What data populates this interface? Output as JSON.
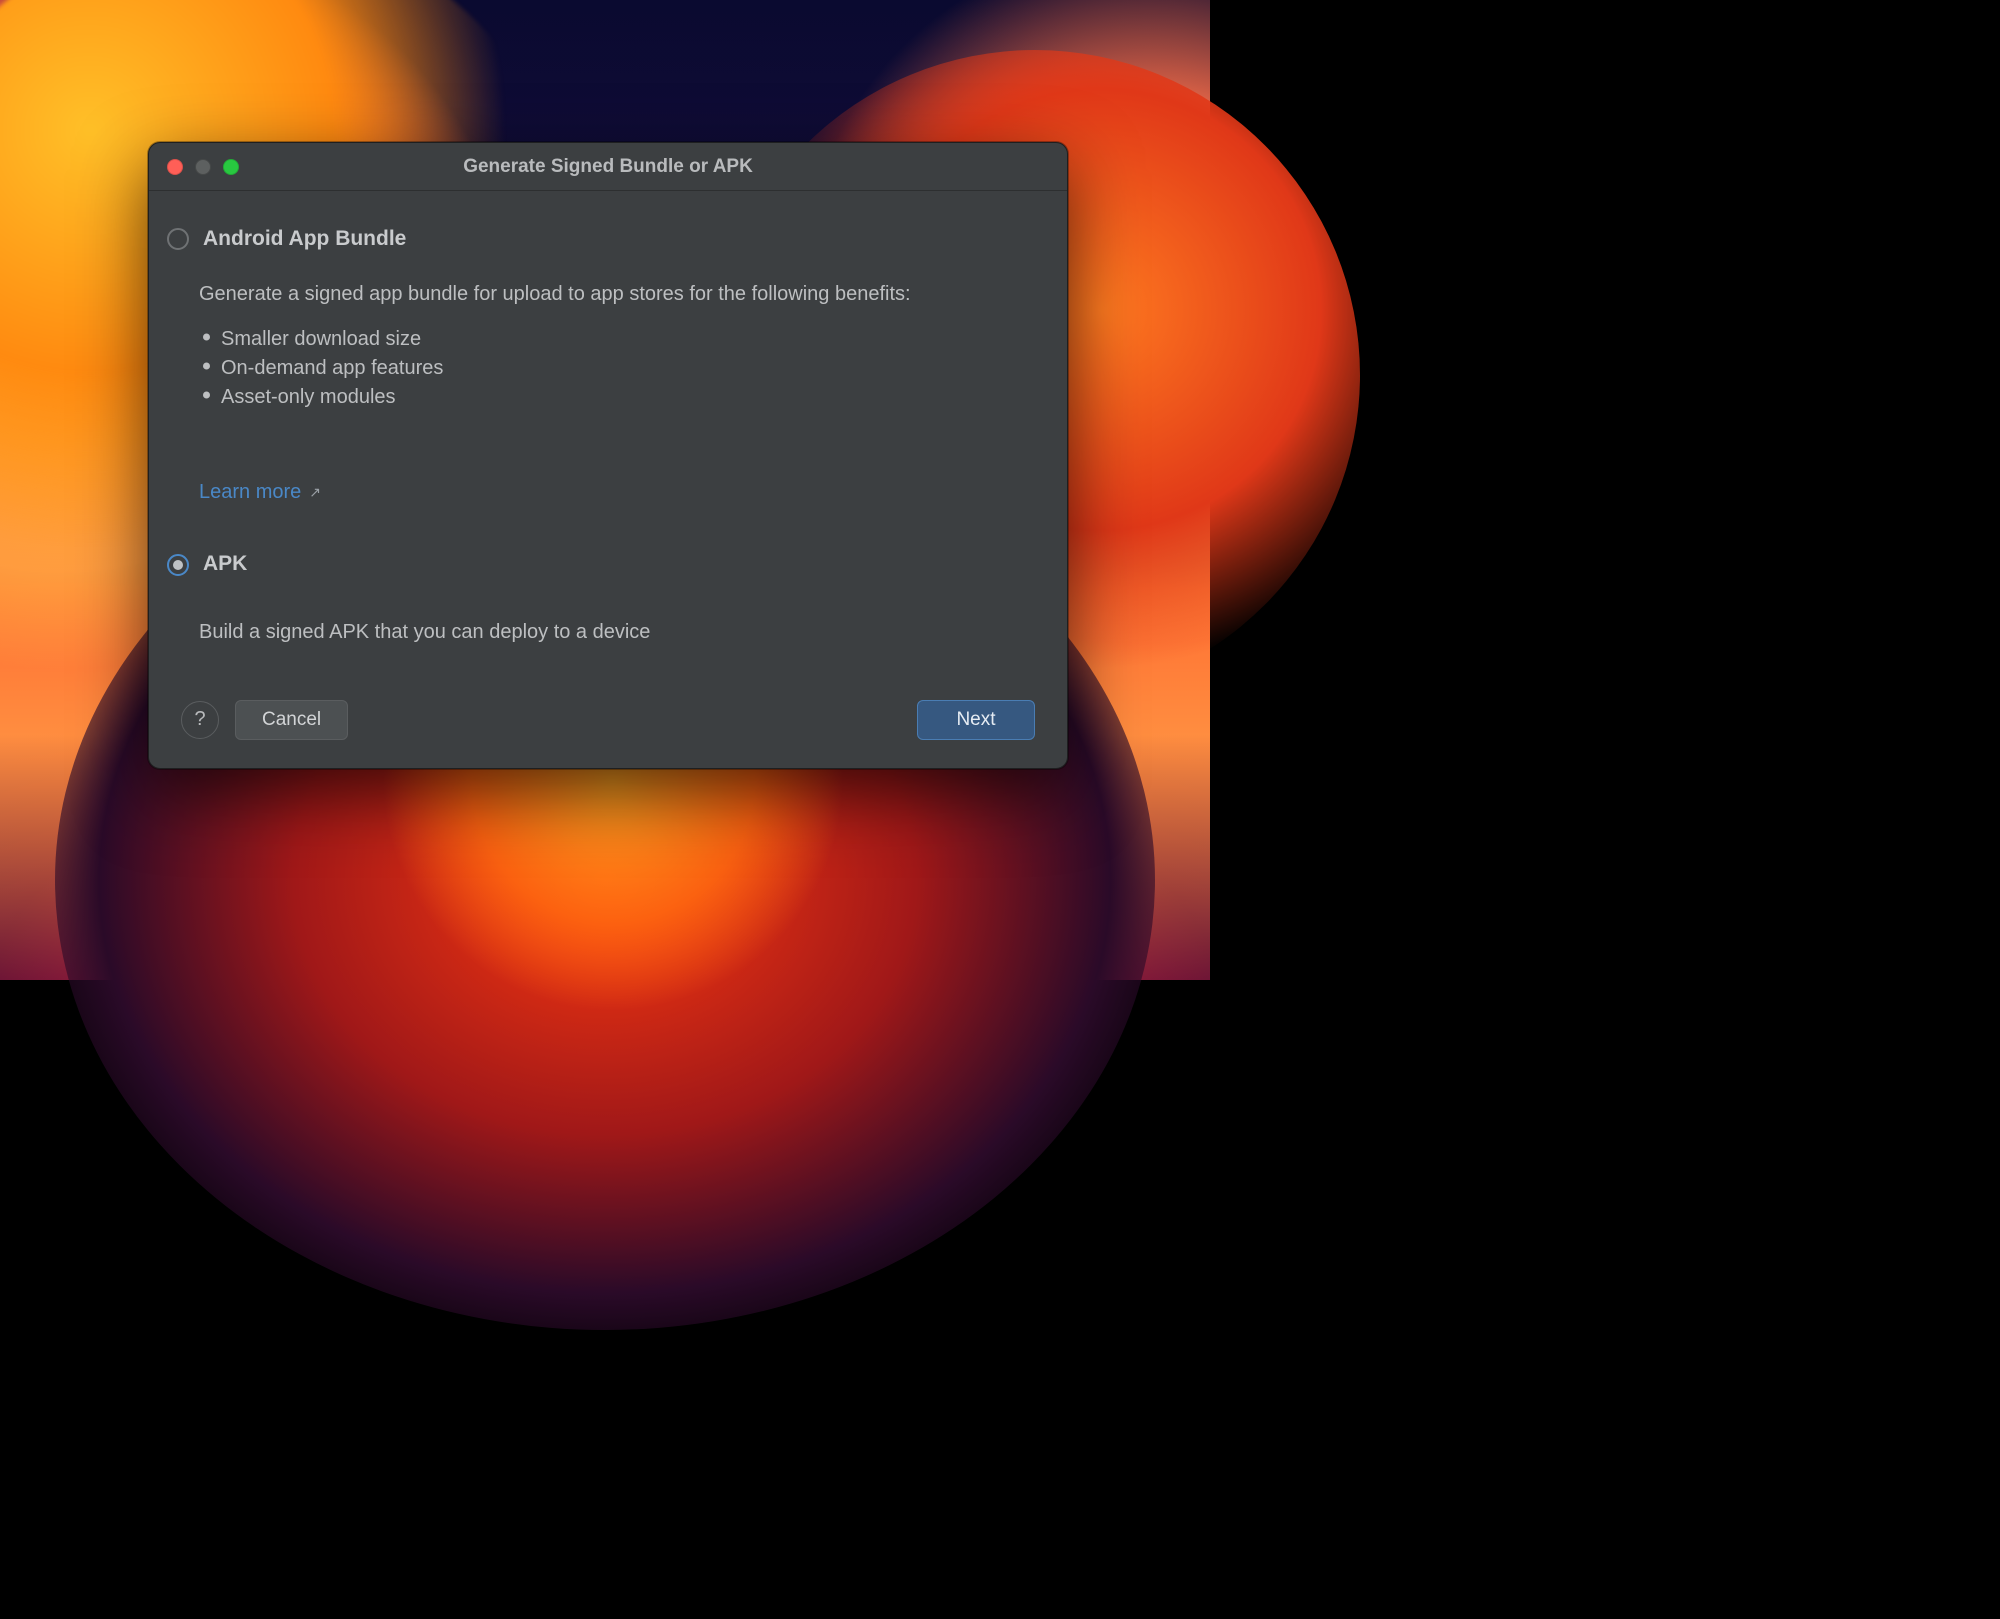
{
  "dialog": {
    "title": "Generate Signed Bundle or APK",
    "options": {
      "bundle": {
        "label": "Android App Bundle",
        "selected": false,
        "description": "Generate a signed app bundle for upload to app stores for the following benefits:",
        "benefits": [
          "Smaller download size",
          "On-demand app features",
          "Asset-only modules"
        ],
        "learn_more_label": "Learn more"
      },
      "apk": {
        "label": "APK",
        "selected": true,
        "description": "Build a signed APK that you can deploy to a device"
      }
    },
    "buttons": {
      "help": "?",
      "cancel": "Cancel",
      "next": "Next"
    }
  }
}
